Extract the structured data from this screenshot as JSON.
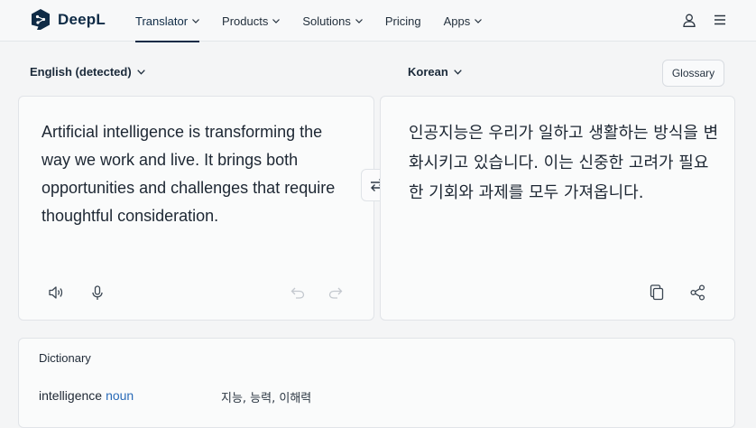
{
  "app": {
    "name": "DeepL"
  },
  "nav": {
    "items": [
      {
        "label": "Translator",
        "dropdown": true,
        "active": true
      },
      {
        "label": "Products",
        "dropdown": true
      },
      {
        "label": "Solutions",
        "dropdown": true
      },
      {
        "label": "Pricing",
        "dropdown": false
      },
      {
        "label": "Apps",
        "dropdown": true
      }
    ],
    "right_icons": [
      "user-icon",
      "hamburger-menu-icon"
    ]
  },
  "source": {
    "language": "English (detected)",
    "text": "Artificial intelligence is transforming the way we work and live. It brings both opportunities and challenges that require thoughtful consideration.",
    "icons": [
      "speaker-icon",
      "microphone-icon",
      "undo-icon",
      "redo-icon"
    ]
  },
  "target": {
    "language": "Korean",
    "glossary_label": "Glossary",
    "text": "인공지능은 우리가 일하고 생활하는 방식을 변화시키고 있습니다. 이는 신중한 고려가 필요한 기회와 과제를 모두 가져옵니다.",
    "icons": [
      "copy-icon",
      "share-icon"
    ]
  },
  "swap_icon": "swap-arrows-icon",
  "dictionary": {
    "title": "Dictionary",
    "entries": [
      {
        "term": "intelligence",
        "pos": "noun",
        "translations": "지능, 능력, 이해력"
      }
    ]
  },
  "colors": {
    "brand": "#0f2b46",
    "accent": "#2a6bb8",
    "background": "#f4f5f6"
  }
}
